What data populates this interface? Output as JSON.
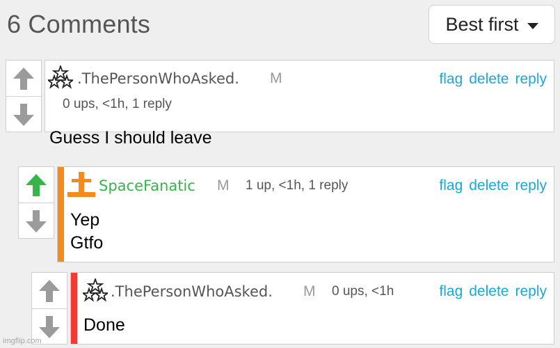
{
  "header": {
    "title": "6 Comments",
    "sort": {
      "selected": "Best first"
    }
  },
  "comments": [
    {
      "username": ".ThePersonWhoAsked.",
      "badge": "M",
      "meta": "0 ups, <1h, 1 reply",
      "body": [
        "Guess I should leave"
      ],
      "actions": {
        "flag": "flag",
        "delete": "delete",
        "reply": "reply"
      },
      "upvoted": false,
      "stripe_color": null,
      "icon": "stars-icon"
    },
    {
      "username": "SpaceFanatic",
      "badge": "M",
      "meta": "1 up, <1h, 1 reply",
      "body": [
        "Yep",
        "Gtfo"
      ],
      "actions": {
        "flag": "flag",
        "delete": "delete",
        "reply": "reply"
      },
      "upvoted": true,
      "stripe_color": "#f78a1d",
      "icon": "mod-cross-icon",
      "username_color": "#35b54a"
    },
    {
      "username": ".ThePersonWhoAsked.",
      "badge": "M",
      "meta": "0 ups, <1h",
      "body": [
        "Done"
      ],
      "actions": {
        "flag": "flag",
        "delete": "delete",
        "reply": "reply"
      },
      "upvoted": false,
      "stripe_color": "#f23a32",
      "icon": "stars-icon"
    }
  ],
  "colors": {
    "link": "#18a9d6",
    "upvote_active": "#35b54a",
    "arrow_inactive": "#9b9b9b"
  },
  "watermark": "imgflip.com"
}
